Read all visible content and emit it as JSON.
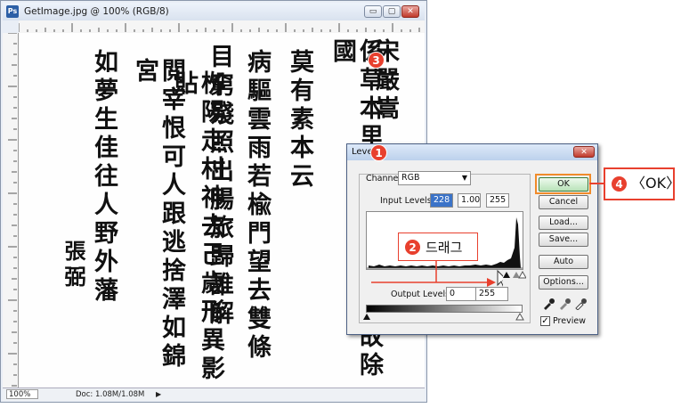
{
  "document_window": {
    "title": "GetImage.jpg @ 100% (RGB/8)",
    "app_icon": "Ps",
    "controls": {
      "minimize": "▭",
      "maximize": "▢",
      "close": "✕"
    },
    "status": {
      "zoom": "100%",
      "doc_info": "Doc: 1.08M/1.08M",
      "arrow": "▶"
    }
  },
  "calligraphy": [
    {
      "text": "宋嚴嵩"
    },
    {
      "text": "係草本里望上又和藩子故除國"
    },
    {
      "text": "莫有素本云"
    },
    {
      "text": "病驅雲雨若楡門望去雙條"
    },
    {
      "text": "目窮殘照出腸旅歸誰解"
    },
    {
      "text": "栁陽走村神去己歲形異影貼"
    },
    {
      "text": "閲宰恨可人跟逃捨澤如錦宮"
    },
    {
      "text": "如夢生佳往人野外藩"
    },
    {
      "text": "張弼"
    }
  ],
  "levels_dialog": {
    "title": "Levels",
    "close": "✕",
    "channel_label": "Channel:",
    "channel_value": "RGB",
    "input_levels_label": "Input Levels:",
    "input_black": "228",
    "input_gamma": "1.00",
    "input_white": "255",
    "output_levels_label": "Output Levels:",
    "output_black": "0",
    "output_white": "255",
    "buttons": {
      "ok": "OK",
      "cancel": "Cancel",
      "load": "Load...",
      "save": "Save...",
      "auto": "Auto",
      "options": "Options..."
    },
    "preview_label": "Preview",
    "preview_checked": true
  },
  "callouts": {
    "step1": "1",
    "step2": "2",
    "step2_text": "드래그",
    "step3": "3",
    "step4": "4",
    "step4_text": "〈OK〉"
  },
  "colors": {
    "callout_red": "#e8402e",
    "ok_highlight": "#f08b2a",
    "title_blue": "#c8daf2"
  }
}
